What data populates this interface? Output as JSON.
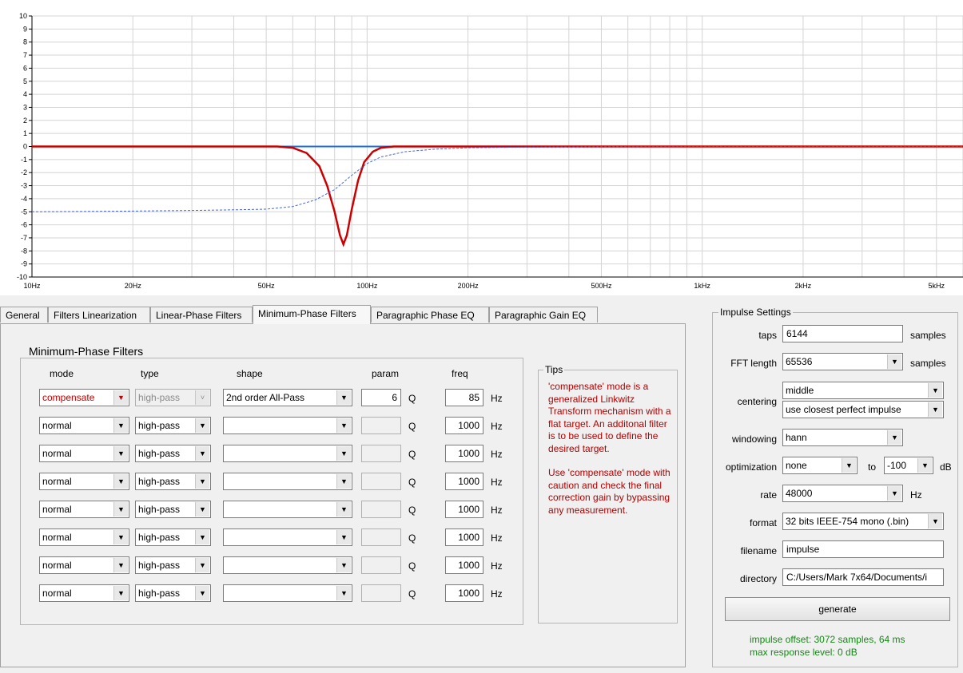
{
  "chart_data": {
    "type": "line",
    "y_ticks": [
      "10",
      "9",
      "8",
      "7",
      "6",
      "5",
      "4",
      "3",
      "2",
      "1",
      "0",
      "-1",
      "-2",
      "-3",
      "-4",
      "-5",
      "-6",
      "-7",
      "-8",
      "-9",
      "-10"
    ],
    "x_ticks": [
      "10Hz",
      "20Hz",
      "50Hz",
      "100Hz",
      "200Hz",
      "500Hz",
      "1kHz",
      "2kHz",
      "5kHz"
    ],
    "ylim": [
      -10,
      10
    ],
    "xlim": [
      10,
      6000
    ],
    "x_scale": "log",
    "grid": true,
    "series": [
      {
        "color": "#1e6fe0",
        "style": "solid",
        "x": [
          10,
          6000
        ],
        "y": [
          0,
          0
        ]
      },
      {
        "color": "#cc0000",
        "style": "solid",
        "x": [
          10,
          54,
          60,
          66,
          72,
          76,
          80,
          83,
          85,
          87,
          90,
          94,
          98,
          104,
          110,
          120,
          140,
          6000
        ],
        "y": [
          0,
          0,
          -0.1,
          -0.5,
          -1.5,
          -3,
          -5,
          -6.8,
          -7.5,
          -6.8,
          -4.8,
          -2.6,
          -1.2,
          -0.4,
          -0.1,
          0,
          0,
          0
        ]
      },
      {
        "color": "#4466dd",
        "style": "dashed",
        "x": [
          10,
          20,
          30,
          40,
          50,
          60,
          70,
          80,
          90,
          100,
          110,
          130,
          160,
          200,
          300,
          500,
          1000,
          6000
        ],
        "y": [
          -5,
          -4.95,
          -4.9,
          -4.85,
          -4.8,
          -4.6,
          -4.1,
          -3.3,
          -2.2,
          -1.3,
          -0.8,
          -0.4,
          -0.2,
          -0.1,
          -0.05,
          -0.02,
          0,
          0
        ]
      },
      {
        "color": "#dd2222",
        "style": "dashed",
        "x": [
          600,
          6000
        ],
        "y": [
          0,
          0
        ]
      }
    ]
  },
  "tabs": [
    "General",
    "Filters Linearization",
    "Linear-Phase Filters",
    "Minimum-Phase Filters",
    "Paragraphic Phase EQ",
    "Paragraphic Gain EQ"
  ],
  "active_tab": "Minimum-Phase Filters",
  "mpf": {
    "title": "Minimum-Phase Filters",
    "headers": {
      "mode": "mode",
      "type": "type",
      "shape": "shape",
      "param": "param",
      "freq": "freq"
    },
    "q_unit": "Q",
    "hz_unit": "Hz",
    "rows": [
      {
        "mode": "compensate",
        "type": "high-pass",
        "shape": "2nd order All-Pass",
        "param": "6",
        "freq": "85"
      },
      {
        "mode": "normal",
        "type": "high-pass",
        "shape": "",
        "param": "",
        "freq": "1000"
      },
      {
        "mode": "normal",
        "type": "high-pass",
        "shape": "",
        "param": "",
        "freq": "1000"
      },
      {
        "mode": "normal",
        "type": "high-pass",
        "shape": "",
        "param": "",
        "freq": "1000"
      },
      {
        "mode": "normal",
        "type": "high-pass",
        "shape": "",
        "param": "",
        "freq": "1000"
      },
      {
        "mode": "normal",
        "type": "high-pass",
        "shape": "",
        "param": "",
        "freq": "1000"
      },
      {
        "mode": "normal",
        "type": "high-pass",
        "shape": "",
        "param": "",
        "freq": "1000"
      },
      {
        "mode": "normal",
        "type": "high-pass",
        "shape": "",
        "param": "",
        "freq": "1000"
      }
    ]
  },
  "tips": {
    "title": "Tips",
    "p1": "'compensate' mode is a generalized Linkwitz Transform mechanism with a flat target. An additonal filter is to be used to define the desired target.",
    "p2": "Use 'compensate' mode with caution and check the final correction gain by bypassing any measurement."
  },
  "impulse": {
    "title": "Impulse Settings",
    "taps_label": "taps",
    "taps": "6144",
    "taps_unit": "samples",
    "fft_label": "FFT length",
    "fft": "65536",
    "fft_unit": "samples",
    "centering_label": "centering",
    "centering": "middle",
    "centering2": "use closest perfect impulse",
    "windowing_label": "windowing",
    "windowing": "hann",
    "optimization_label": "optimization",
    "optimization": "none",
    "to_label": "to",
    "opt_level": "-100",
    "db_unit": "dB",
    "rate_label": "rate",
    "rate": "48000",
    "rate_unit": "Hz",
    "format_label": "format",
    "format": "32 bits IEEE-754 mono (.bin)",
    "filename_label": "filename",
    "filename": "impulse",
    "directory_label": "directory",
    "directory": "C:/Users/Mark 7x64/Documents/i",
    "generate": "generate",
    "status1": "impulse offset: 3072 samples, 64 ms",
    "status2": "max response level: 0 dB"
  }
}
